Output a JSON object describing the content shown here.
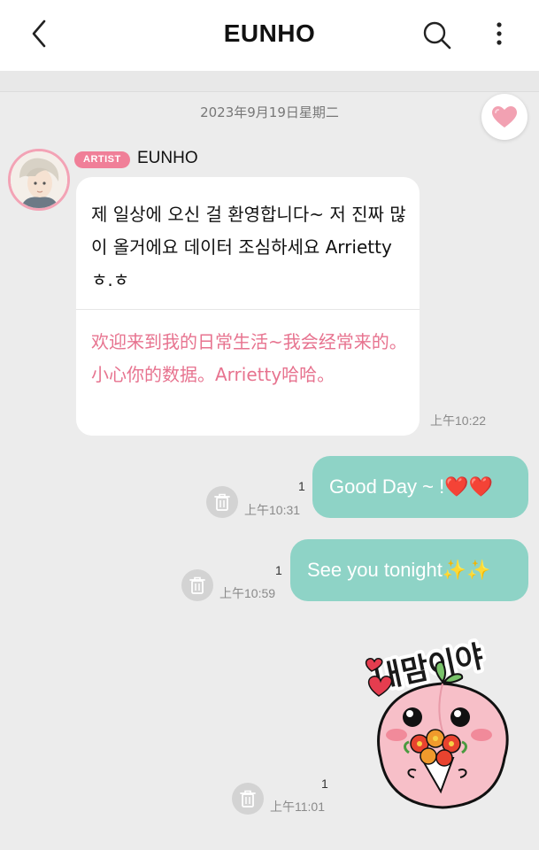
{
  "header": {
    "title": "EUNHO",
    "icons": [
      "chevron-left-icon",
      "search-icon",
      "more-vertical-icon"
    ]
  },
  "date_separator": "2023年9月19日星期二",
  "artist_message": {
    "badge": "ARTIST",
    "sender": "EUNHO",
    "text_ko": "제 일상에 오신 걸 환영합니다~ 저 진짜 많이 올거에요 데이터 조심하세요 Arrietty ㅎ.ㅎ",
    "text_zh": "欢迎来到我的日常生活~我会经常来的。小心你的数据。Arrietty哈哈。",
    "time": "上午10:22"
  },
  "my_messages": [
    {
      "text": "Good Day ~ ! ",
      "emoji": "❤️❤️",
      "count": "1",
      "time": "上午10:31"
    },
    {
      "text": "See you tonight",
      "emoji": "✨✨",
      "count": "1",
      "time": "上午10:59"
    },
    {
      "sticker": true,
      "sticker_text": "내맘이야",
      "count": "1",
      "time": "上午11:01"
    }
  ],
  "colors": {
    "accent_pink": "#f07f98",
    "translation_pink": "#e7738f",
    "my_bubble": "#8ed3c6",
    "background": "#ececec"
  }
}
